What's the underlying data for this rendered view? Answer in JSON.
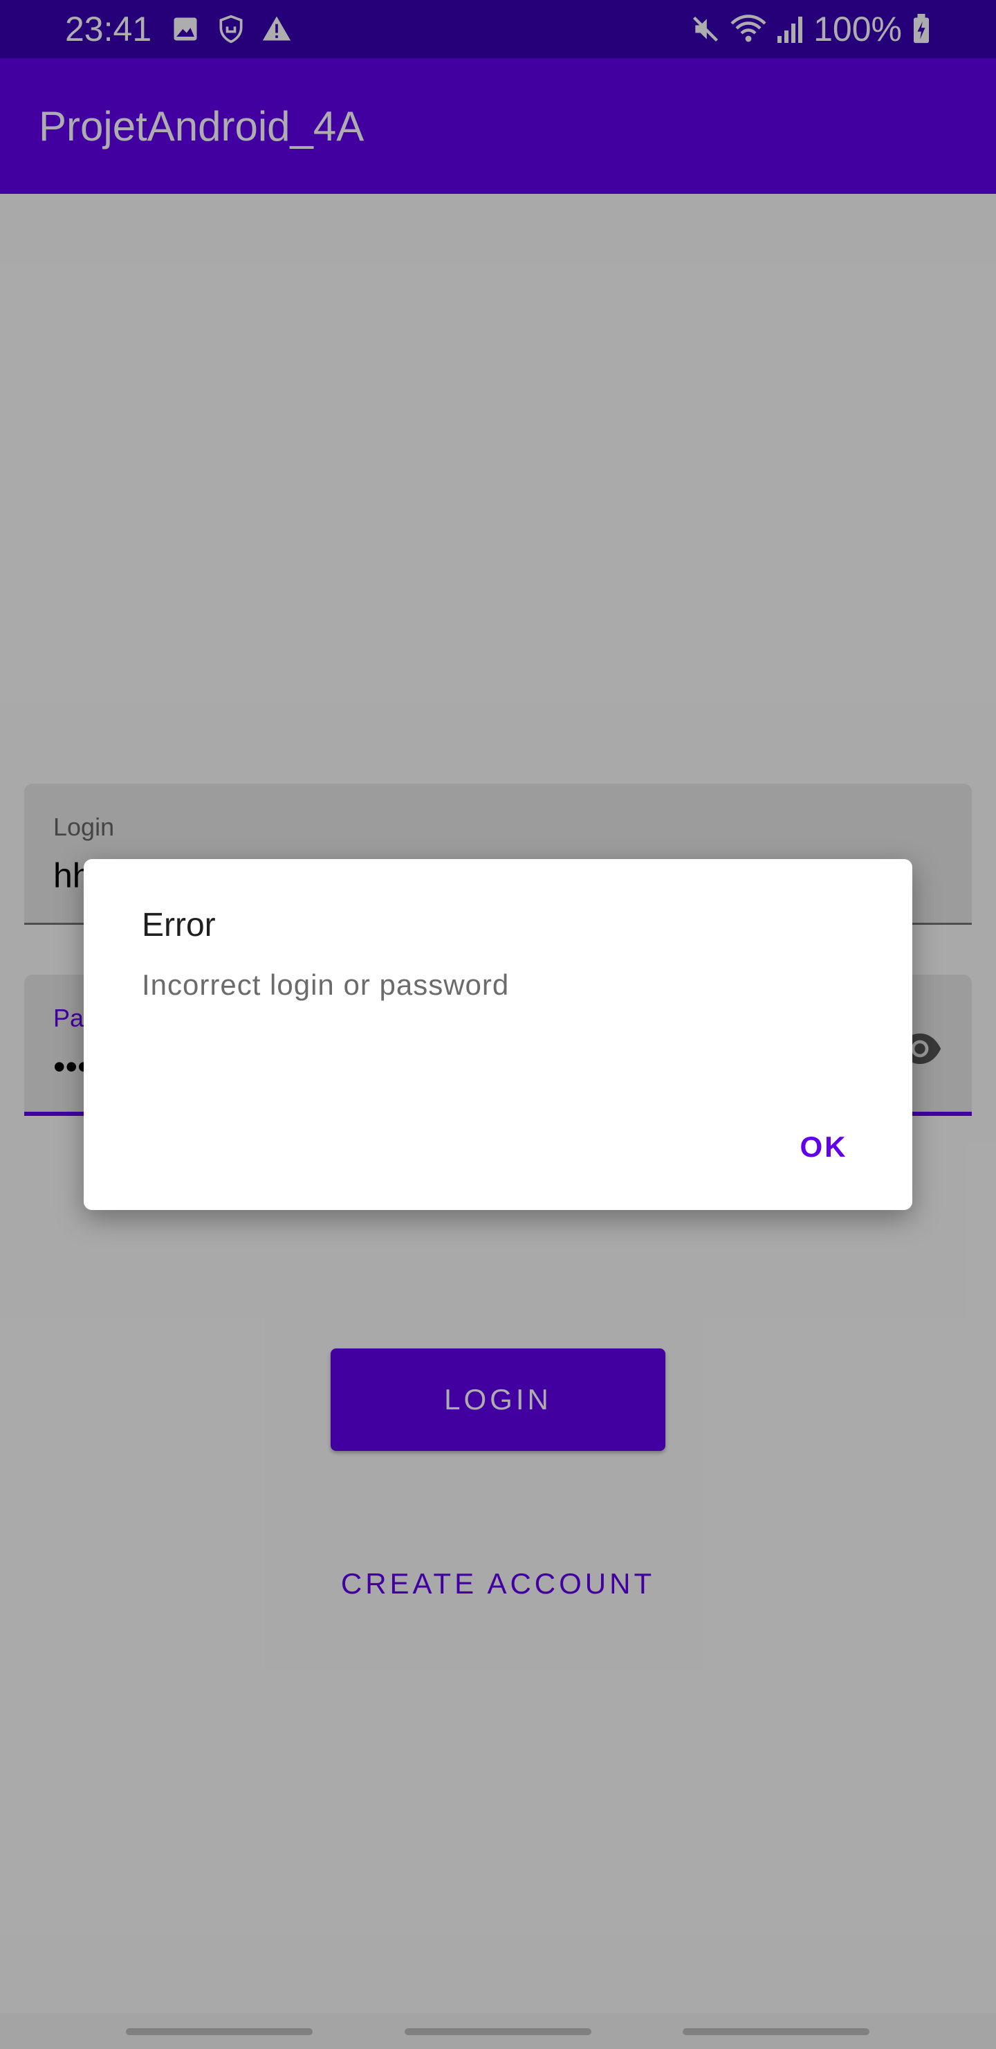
{
  "status_bar": {
    "time": "23:41",
    "battery": "100%",
    "left_icons": [
      "image-icon",
      "shield-icon",
      "warning-icon"
    ],
    "right_icons": [
      "mute-icon",
      "wifi-icon",
      "signal-icon",
      "battery-charging-icon"
    ]
  },
  "app_bar": {
    "title": "ProjetAndroid_4A",
    "color": "#6200ee"
  },
  "form": {
    "login_label": "Login",
    "login_value": "hh",
    "password_label": "Password",
    "password_value": "•••",
    "login_button": "LOGIN",
    "create_account_button": "CREATE ACCOUNT"
  },
  "dialog": {
    "title": "Error",
    "message": "Incorrect login or password",
    "ok_label": "OK"
  },
  "colors": {
    "primary": "#6200ee",
    "status_bar": "#3700b3"
  }
}
